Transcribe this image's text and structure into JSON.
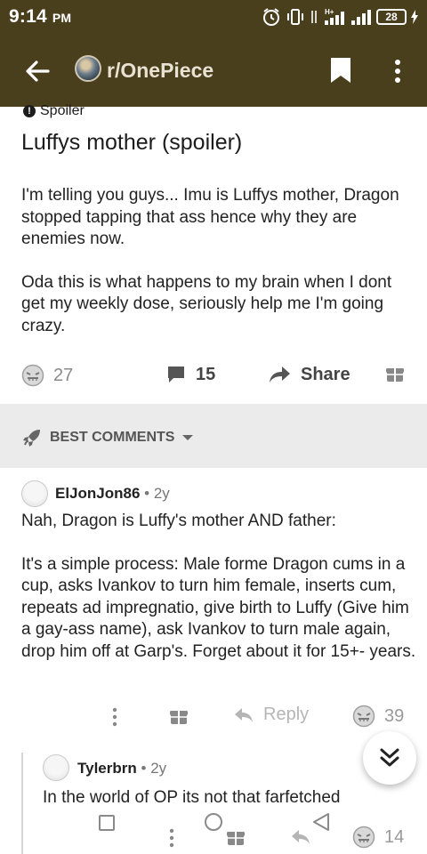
{
  "status_bar": {
    "time": "9:14",
    "ampm": "PM",
    "battery": "28",
    "background": "#4a3f1d"
  },
  "app_bar": {
    "subreddit": "r/OnePiece",
    "background": "#4a3f1d",
    "icons": [
      "back-arrow-icon",
      "bookmark-icon",
      "more-vert-icon"
    ]
  },
  "post": {
    "flair": "Spoiler",
    "title": "Luffys mother (spoiler)",
    "body": [
      "I'm telling you guys... Imu is Luffys mother, Dragon stopped tapping that ass hence why they are enemies now.",
      "Oda this is what happens to my brain when I dont get my weekly dose, seriously help me I'm going crazy."
    ],
    "upvotes": "27",
    "comments": "15",
    "share_label": "Share"
  },
  "sort": {
    "label": "BEST COMMENTS"
  },
  "comments": [
    {
      "author": "ElJonJon86",
      "age": "2y",
      "body": [
        "Nah, Dragon is Luffy's mother AND father:",
        "It's a simple process: Male forme Dragon cums in a cup, asks Ivankov to turn him female, inserts cum, repeats ad impregnatio, give birth to Luffy (Give him a gay-ass name), ask Ivankov to turn male again, drop him off at Garp's. Forget about it for 15+- years."
      ],
      "reply_label": "Reply",
      "votes": "39"
    },
    {
      "author": "Tylerbrn",
      "age": "2y",
      "body": [
        "In the world of OP its not that farfetched"
      ],
      "votes": "14"
    }
  ]
}
